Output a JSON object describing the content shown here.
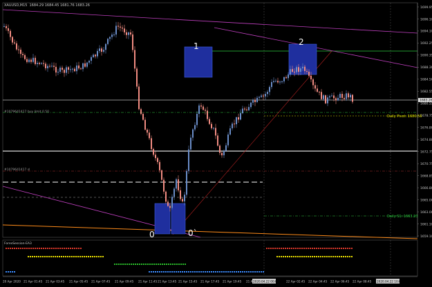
{
  "window": {
    "symbol_title": "XAUUSD,M15",
    "ohlc_text": "1684.29 1684.45 1681.76 1683.26"
  },
  "price_axis": {
    "ticks": [
      "1699.95",
      "1696.10",
      "1694.10",
      "1692.25",
      "1690.35",
      "1688.30",
      "1684.50",
      "1682.55",
      "1680.55",
      "1678.75",
      "1676.80",
      "1674.80",
      "1672.75",
      "1670.75",
      "1668.85",
      "1666.80",
      "1665.00",
      "1663.00",
      "1661.10",
      "1659.10"
    ],
    "current_price": "1683.26"
  },
  "time_axis": {
    "labels": [
      "20 Apr 2020",
      "21 Apr 01:45",
      "21 Apr 03:45",
      "21 Apr 05:45",
      "21 Apr 07:45",
      "21 Apr 09:45",
      "21 Apr 11:45",
      "21 Apr 13:45",
      "21 Apr 15:45",
      "21 Apr 17:45",
      "21 Apr 19:45",
      "21 Apr 21:45",
      "2020.04.22 00:00",
      "22 Apr 02:45",
      "22 Apr 04:45",
      "22 Apr 06:45",
      "22 Apr 08:45",
      "2020.04.22 10:00"
    ]
  },
  "annotations": {
    "buy_level": "#1079641417 buy limit 0.50",
    "sl_level": "#1079641417 sl",
    "daily_pivot": "Daily Pivot: 1680.56",
    "daily_s1": "Daily S1: 1663.23",
    "box_1": "1",
    "box_2": "2",
    "box_0a": "0",
    "box_0b": "0`"
  },
  "indicator": {
    "name": "ForexSession-EA3"
  },
  "colors": {
    "background": "#000000",
    "bull_candle": "#6b8ec9",
    "bear_candle": "#f28c82",
    "grid": "#3a3a3a",
    "axis_text": "#c8c8c8",
    "box": "#1f2f9e",
    "pivot": "#e6e600",
    "s1": "#2ecc40",
    "resistance": "#2ecc40",
    "trendline": "#c040c0",
    "support_orange": "#ff8c1a",
    "session_red": "#e0392b",
    "session_yellow": "#f2e600",
    "session_green": "#2bbf2b",
    "session_blue": "#3c8cff"
  }
}
